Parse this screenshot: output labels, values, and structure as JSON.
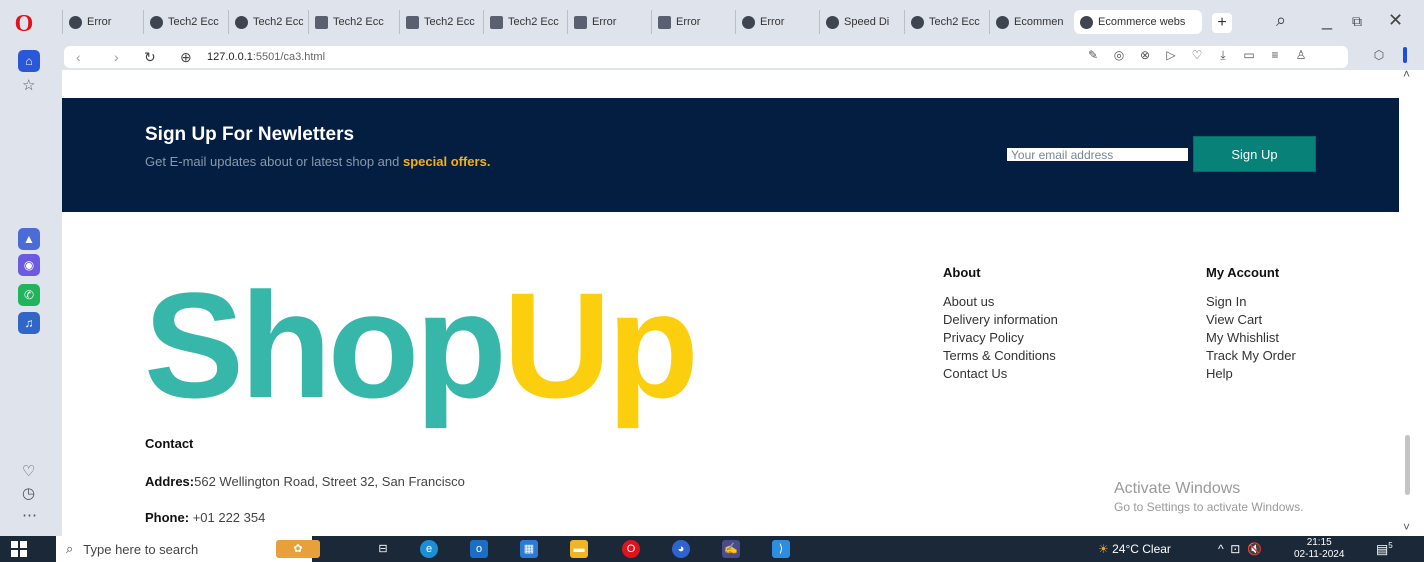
{
  "browser": {
    "tabs": [
      {
        "label": "Error",
        "icon": "globe-icon"
      },
      {
        "label": "Tech2 Ecc",
        "icon": "globe-icon"
      },
      {
        "label": "Tech2 Ecc",
        "icon": "globe-icon"
      },
      {
        "label": "Tech2 Ecc",
        "icon": "doc-icon"
      },
      {
        "label": "Tech2 Ecc",
        "icon": "doc-icon"
      },
      {
        "label": "Tech2 Ecc",
        "icon": "doc-icon"
      },
      {
        "label": "Error",
        "icon": "doc-icon"
      },
      {
        "label": "Error",
        "icon": "doc-icon"
      },
      {
        "label": "Error",
        "icon": "globe-icon"
      },
      {
        "label": "Speed Di",
        "icon": "grid-icon"
      },
      {
        "label": "Tech2 Ecc",
        "icon": "globe-icon"
      },
      {
        "label": "Ecommen",
        "icon": "globe-icon"
      },
      {
        "label": "Ecommerce webs",
        "icon": "globe-icon"
      }
    ],
    "new_tab": "+",
    "url_host": "127.0.0.1",
    "url_rest": ":5501/ca3.html"
  },
  "newsletter": {
    "title": "Sign Up For Newletters",
    "subtitle_prefix": "Get E-mail updates about or latest shop and ",
    "subtitle_highlight": "special offers.",
    "email_placeholder": "Your email address",
    "button_label": "Sign Up"
  },
  "logo": {
    "part1": "Shop",
    "part2": "Up"
  },
  "footer": {
    "about": {
      "heading": "About",
      "links": [
        "About us",
        "Delivery information",
        "Privacy Policy",
        "Terms & Conditions",
        "Contact Us"
      ]
    },
    "account": {
      "heading": "My Account",
      "links": [
        "Sign In",
        "View Cart",
        "My Whishlist",
        "Track My Order",
        "Help"
      ]
    },
    "contact": {
      "heading": "Contact",
      "address_label": "Addres:",
      "address_value": "562 Wellington Road, Street 32, San Francisco",
      "phone_label": "Phone:",
      "phone_value": "+01 222 354"
    }
  },
  "watermark": {
    "title": "Activate Windows",
    "subtitle": "Go to Settings to activate Windows."
  },
  "taskbar": {
    "search_placeholder": "Type here to search",
    "weather": "24°C  Clear",
    "time": "21:15",
    "date": "02-11-2024",
    "notification_count": "5"
  },
  "colors": {
    "newsletter_bg": "#041e42",
    "accent_button": "#088178",
    "highlight": "#f5b017",
    "logo_teal": "#37b7aa",
    "logo_yellow": "#fccf0e"
  }
}
